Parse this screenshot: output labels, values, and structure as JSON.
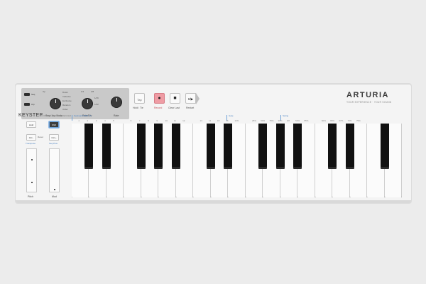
{
  "brand": {
    "logo": "ARTURIA",
    "tagline": "YOUR EXPERIENCE · YOUR SOUND"
  },
  "model": {
    "name": "KEYSTEP",
    "subtitle": "CONTROLLER · SEQUENCER"
  },
  "knob_panel": {
    "switch_labels": [
      "Seq",
      "Arp"
    ],
    "knob_labels": [
      "Seq / Arp Mode",
      "Rate/Div",
      "Rate"
    ],
    "mode_options": [
      "Up",
      "Down",
      "Inclusive",
      "Exclusive",
      "Random",
      "Order"
    ],
    "rate_options": [
      "1/4",
      "1/8",
      "1/16",
      "1/32"
    ]
  },
  "transport": {
    "hold_glyph": "Tap",
    "record_glyph": "●",
    "stop_glyph": "■",
    "play_glyph": "II/▶",
    "labels": [
      "Hold / Tie",
      "Record",
      "Clear Last",
      "Restart"
    ]
  },
  "left_controls": {
    "hold_label": "Hold",
    "shift_label": "Shift",
    "oct_minus": "Oct -",
    "oct_plus": "Oct +",
    "transpose_label": "Transpose",
    "seq_plus_label": "Seq Plus",
    "reset_label": "Reset",
    "pitch_label": "Pitch",
    "mod_label": "Mod"
  },
  "keyboard": {
    "section_labels": {
      "midi_ch": "Keyboard MIDI Ch",
      "gate": "Gate",
      "swing": "Swing"
    },
    "midi_channels": [
      "1",
      "2",
      "3",
      "4",
      "5",
      "6",
      "7",
      "8",
      "9",
      "10",
      "11",
      "12",
      "13",
      "14",
      "15",
      "16"
    ],
    "gate_values": [
      "10%",
      "25%",
      "50%",
      "75%",
      "90%"
    ],
    "swing_values": [
      "Off",
      "52%",
      "55%",
      "60%",
      "65%",
      "67%",
      "70%",
      "75%"
    ],
    "white_keys": 19,
    "black_key_positions": [
      1,
      2,
      4,
      5,
      6,
      8,
      9,
      11,
      12,
      13,
      15,
      16,
      18
    ]
  }
}
